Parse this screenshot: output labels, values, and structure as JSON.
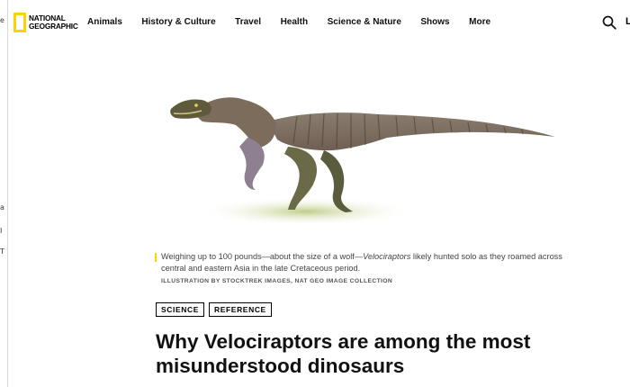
{
  "left_strip": {
    "chars": [
      "e",
      "a",
      "I",
      "T"
    ]
  },
  "brand": {
    "line1": "NATIONAL",
    "line2": "GEOGRAPHIC"
  },
  "nav": {
    "items": [
      "Animals",
      "History & Culture",
      "Travel",
      "Health",
      "Science & Nature",
      "Shows",
      "More"
    ]
  },
  "header": {
    "cut_text": "L"
  },
  "hero": {
    "caption_pre": "Weighing up to 100 pounds—about the size of a wolf—",
    "caption_em": "Velociraptors",
    "caption_post": " likely hunted solo as they roamed across central and eastern Asia in the late Cretaceous period.",
    "credit": "ILLUSTRATION BY STOCKTREK IMAGES, NAT GEO IMAGE COLLECTION"
  },
  "tags": [
    "SCIENCE",
    "REFERENCE"
  ],
  "article": {
    "headline_line1": "Why Velociraptors are among the most",
    "headline_line2": "misunderstood dinosaurs"
  },
  "colors": {
    "accent": "#ffd200",
    "text": "#111111"
  }
}
